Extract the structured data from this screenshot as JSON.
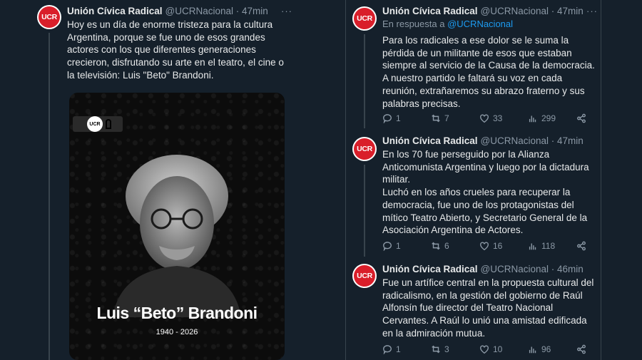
{
  "colors": {
    "background": "#15202b",
    "text": "#e7e9ea",
    "secondary": "#8b98a5",
    "link": "#1d9bf0",
    "ucr_red": "#d91e2a"
  },
  "left_tweet": {
    "avatar_text": "UCR",
    "name": "Unión Cívica Radical",
    "handle_time": "@UCRNacional · 47min",
    "more_icon": "more-dots-icon",
    "text": "Hoy es un día de enorme tristeza para la cultura Argentina, porque se fue uno de esos grandes actores con los que diferentes generaciones crecieron, disfrutando su arte en el teatro, el cine o la televisión: Luis \"Beto\" Brandoni.",
    "media": {
      "logo_text": "UCR",
      "name": "Luis “Beto” Brandoni",
      "dates": "1940 - 2026"
    }
  },
  "right_tweets": [
    {
      "avatar_text": "UCR",
      "name": "Unión Cívica Radical",
      "handle_time": "@UCRNacional · 47min",
      "reply_prefix": "En respuesta a",
      "reply_mention": "@UCRNacional",
      "text": "Para los radicales a ese dolor se le suma la pérdida de un militante de esos que estaban siempre al servicio de la Causa de la democracia. A nuestro partido le faltará su voz en cada reunión, extrañaremos su abrazo fraterno y sus palabras precisas.",
      "stats": {
        "replies": "1",
        "retweets": "7",
        "likes": "33",
        "views": "299"
      }
    },
    {
      "avatar_text": "UCR",
      "name": "Unión Cívica Radical",
      "handle_time": "@UCRNacional · 47min",
      "text_lines": [
        "En los 70 fue perseguido por la Alianza Anticomunista Argentina y luego por la dictadura militar.",
        "Luchó en los años crueles para recuperar la democracia, fue uno de los protagonistas del mítico Teatro Abierto, y Secretario General de la Asociación Argentina de Actores."
      ],
      "stats": {
        "replies": "1",
        "retweets": "6",
        "likes": "16",
        "views": "118"
      }
    },
    {
      "avatar_text": "UCR",
      "name": "Unión Cívica Radical",
      "handle_time": "@UCRNacional · 46min",
      "text": "Fue un artífice central en la propuesta cultural del radicalismo, en la gestión del gobierno de Raúl Alfonsín fue director del Teatro Nacional Cervantes. A Raúl lo unió una amistad edificada en la admiración mutua.",
      "stats": {
        "replies": "1",
        "retweets": "3",
        "likes": "10",
        "views": "96"
      }
    }
  ]
}
